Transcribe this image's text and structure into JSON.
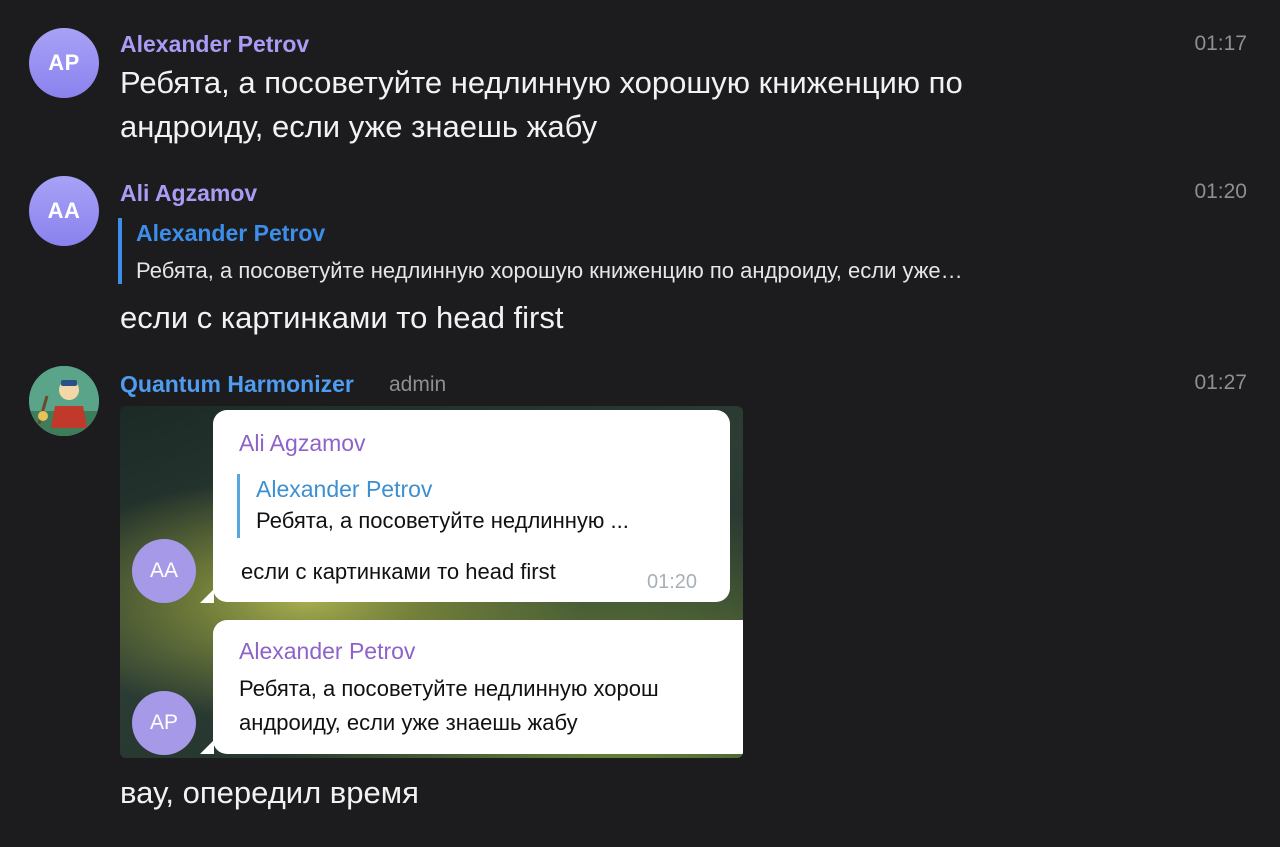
{
  "messages": [
    {
      "avatar_initials": "AP",
      "sender": "Alexander Petrov",
      "time": "01:17",
      "text_line1": "Ребята, а посоветуйте недлинную хорошую книженцию по",
      "text_line2": "андроиду, если уже знаешь жабу"
    },
    {
      "avatar_initials": "AA",
      "sender": "Ali Agzamov",
      "time": "01:20",
      "reply": {
        "sender": "Alexander Petrov",
        "text": "Ребята, а посоветуйте недлинную хорошую книженцию по андроиду, если уже…"
      },
      "text": "если с картинками то head first"
    },
    {
      "sender": "Quantum Harmonizer",
      "role": "admin",
      "time": "01:27",
      "screenshot": {
        "bubble1": {
          "avatar_initials": "AA",
          "sender": "Ali Agzamov",
          "reply_sender": "Alexander Petrov",
          "reply_text": "Ребята, а посоветуйте недлинную ...",
          "text": "если с картинками то head first",
          "time": "01:20"
        },
        "bubble2": {
          "avatar_initials": "AP",
          "sender": "Alexander Petrov",
          "text_line1": "Ребята, а посоветуйте недлинную хорош",
          "text_line2": "андроиду, если уже знаешь жабу"
        }
      },
      "text": "вау, опередил время"
    }
  ],
  "colors": {
    "background": "#1c1c1e",
    "sender_purple": "#a99cf4",
    "sender_blue": "#4f9cf0",
    "reply_accent": "#3d8ee8",
    "avatar": "#978ff1"
  }
}
